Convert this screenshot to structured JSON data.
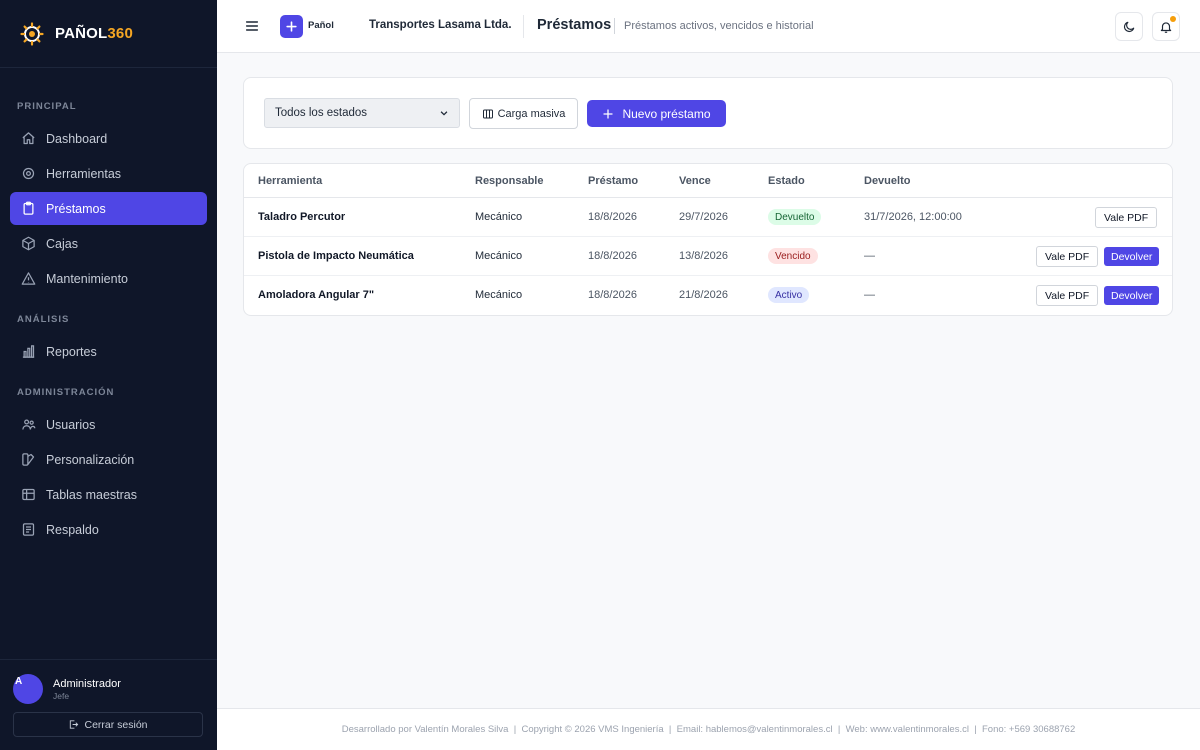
{
  "brand": {
    "name_main": "PAÑOL",
    "name_accent": "360",
    "accent_color": "#f5a623"
  },
  "sidebar": {
    "sections": [
      "PRINCIPAL",
      "ANÁLISIS",
      "ADMINISTRACIÓN"
    ],
    "items": [
      {
        "label": "Dashboard",
        "icon": "home-icon",
        "active": false
      },
      {
        "label": "Herramientas",
        "icon": "gear-icon",
        "active": false
      },
      {
        "label": "Préstamos",
        "icon": "clipboard-icon",
        "active": true
      },
      {
        "label": "Cajas",
        "icon": "box-icon",
        "active": false
      },
      {
        "label": "Mantenimiento",
        "icon": "warning-icon",
        "active": false
      },
      {
        "label": "Reportes",
        "icon": "bar-chart-icon",
        "active": false
      },
      {
        "label": "Usuarios",
        "icon": "users-icon",
        "active": false
      },
      {
        "label": "Personalización",
        "icon": "palette-icon",
        "active": false
      },
      {
        "label": "Tablas maestras",
        "icon": "table-icon",
        "active": false
      },
      {
        "label": "Respaldo",
        "icon": "backup-icon",
        "active": false
      }
    ],
    "user": {
      "initial": "A",
      "name": "Administrador",
      "role": "Jefe"
    },
    "logout_label": "Cerrar sesión"
  },
  "header": {
    "panol_label": "Pañol",
    "company": "Transportes Lasama Ltda.",
    "title": "Préstamos",
    "subtitle": "Préstamos activos, vencidos e historial"
  },
  "filters": {
    "status_selected": "Todos los estados",
    "bulk_label": "Carga masiva",
    "new_label": "Nuevo préstamo"
  },
  "table": {
    "columns": [
      "Herramienta",
      "Responsable",
      "Préstamo",
      "Vence",
      "Estado",
      "Devuelto"
    ],
    "rows": [
      {
        "tool": "Taladro Percutor",
        "responsible": "Mecánico",
        "loan": "18/8/2026",
        "due": "29/7/2026",
        "status": "Devuelto",
        "returned": "31/7/2026, 12:00:00",
        "pdf_label": "Vale PDF",
        "return_label": ""
      },
      {
        "tool": "Pistola de Impacto Neumática",
        "responsible": "Mecánico",
        "loan": "18/8/2026",
        "due": "13/8/2026",
        "status": "Vencido",
        "returned": "—",
        "pdf_label": "Vale PDF",
        "return_label": "Devolver"
      },
      {
        "tool": "Amoladora Angular 7\"",
        "responsible": "Mecánico",
        "loan": "18/8/2026",
        "due": "21/8/2026",
        "status": "Activo",
        "returned": "—",
        "pdf_label": "Vale PDF",
        "return_label": "Devolver"
      }
    ],
    "status_colors": {
      "Devuelto": {
        "bg": "#dcfce7",
        "fg": "#166534"
      },
      "Vencido": {
        "bg": "#fee2e2",
        "fg": "#991b1b"
      },
      "Activo": {
        "bg": "#e0e7ff",
        "fg": "#3730a3"
      }
    }
  },
  "footer": "Desarrollado por Valentín Morales Silva  |  Copyright © 2026 VMS Ingeniería  |  Email: hablemos@valentinmorales.cl  |  Web: www.valentinmorales.cl  |  Fono: +569 30688762"
}
